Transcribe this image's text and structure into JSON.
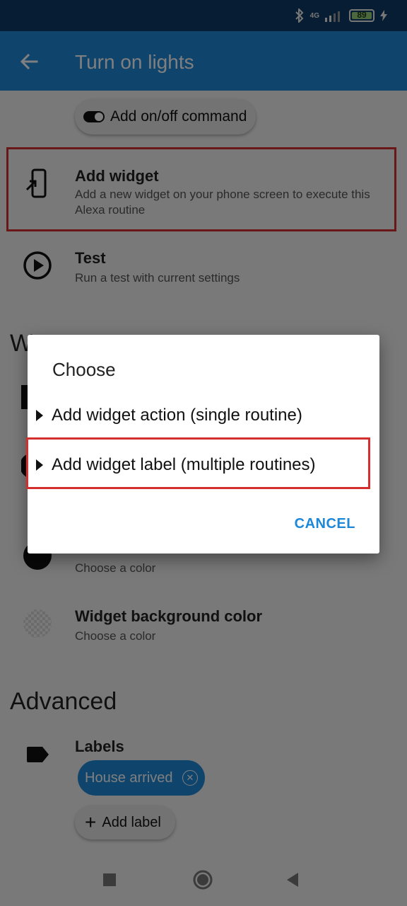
{
  "status_bar": {
    "network": "4G",
    "battery": "89"
  },
  "app_bar": {
    "title": "Turn on lights"
  },
  "content": {
    "onoff_chip": "Add on/off command",
    "add_widget": {
      "title": "Add widget",
      "subtitle": "Add a new widget on your phone screen to execute this Alexa routine"
    },
    "test": {
      "title": "Test",
      "subtitle": "Run a test with current settings"
    },
    "section_partial": "W",
    "widget_color": {
      "subtitle": "Choose a color"
    },
    "widget_bg_color": {
      "title": "Widget background color",
      "subtitle": "Choose a color"
    },
    "advanced_title": "Advanced",
    "labels": {
      "title": "Labels",
      "chip": "House arrived",
      "add_label": "Add label"
    }
  },
  "dialog": {
    "title": "Choose",
    "options": [
      "Add widget action (single routine)",
      "Add widget label (multiple routines)"
    ],
    "cancel": "CANCEL"
  },
  "colors": {
    "app_bar": "#1e88d8",
    "highlight": "#d32f2f",
    "accent": "#1e88d8"
  }
}
